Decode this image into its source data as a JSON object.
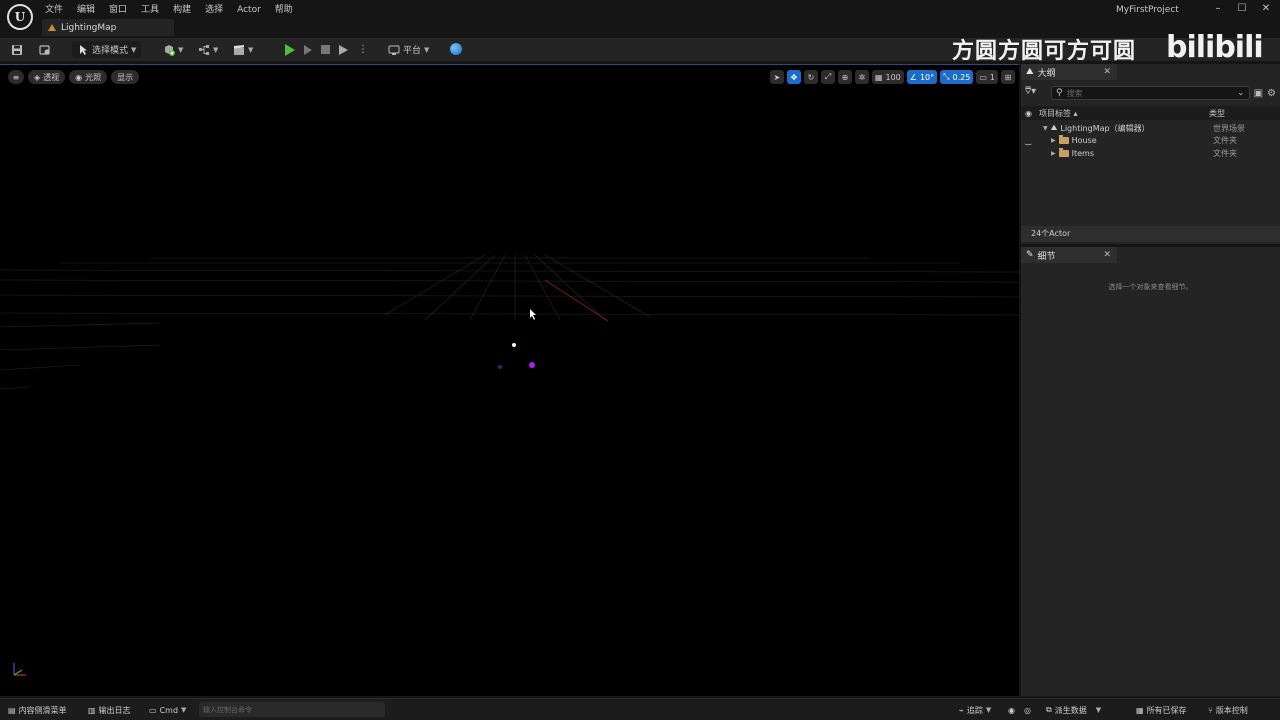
{
  "menu": [
    "文件",
    "编辑",
    "窗口",
    "工具",
    "构建",
    "选择",
    "Actor",
    "帮助"
  ],
  "tab": {
    "label": "LightingMap"
  },
  "project_name": "MyFirstProject",
  "window": {
    "minimize": "–",
    "maximize": "☐",
    "close": "✕"
  },
  "toolbar": {
    "select_mode": "选择模式",
    "platform": "平台"
  },
  "watermark": {
    "text": "方圆方圆可方可圆",
    "logo": "bilibili"
  },
  "viewport": {
    "perspective": "透视",
    "lighting": "光照",
    "show": "显示",
    "grid_snap": "100",
    "rotation_snap": "10°",
    "scale_snap": "0.25",
    "camera_speed": "1"
  },
  "outliner": {
    "title": "大纲",
    "search_placeholder": "搜索",
    "col_label": "项目标签 ▴",
    "col_type": "类型",
    "rows": [
      {
        "name": "LightingMap（编辑器）",
        "type": "世界场景"
      },
      {
        "name": "House",
        "type": "文件夹"
      },
      {
        "name": "Items",
        "type": "文件夹"
      }
    ],
    "actor_count": "24个Actor"
  },
  "details": {
    "title": "细节",
    "empty_message": "选择一个对象来查看细节。"
  },
  "statusbar": {
    "content_drawer": "内容侧滑菜单",
    "output_log": "输出日志",
    "cmd": "Cmd",
    "cmd_placeholder": "输入控制台命令",
    "trace": "追踪",
    "derived_data": "派生数据",
    "all_saved": "所有已保存",
    "source_control": "版本控制"
  }
}
